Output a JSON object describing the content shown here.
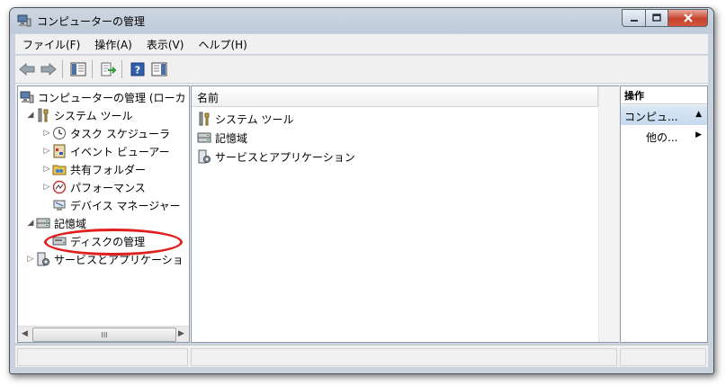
{
  "window": {
    "title": "コンピューターの管理"
  },
  "menubar": {
    "items": [
      "ファイル(F)",
      "操作(A)",
      "表示(V)",
      "ヘルプ(H)"
    ]
  },
  "toolbar": {
    "icons": [
      "back-arrow-icon",
      "forward-arrow-icon",
      "show-hide-tree-icon",
      "export-list-icon",
      "help-icon",
      "show-hide-action-pane-icon"
    ]
  },
  "tree": {
    "root": {
      "label": "コンピューターの管理 (ローカ"
    },
    "items": [
      {
        "label": "システム ツール",
        "state": "expanded"
      },
      {
        "label": "タスク スケジューラ",
        "state": "collapsed"
      },
      {
        "label": "イベント ビューアー",
        "state": "collapsed"
      },
      {
        "label": "共有フォルダー",
        "state": "collapsed"
      },
      {
        "label": "パフォーマンス",
        "state": "collapsed"
      },
      {
        "label": "デバイス マネージャー",
        "state": "leaf"
      },
      {
        "label": "記憶域",
        "state": "expanded"
      },
      {
        "label": "ディスクの管理",
        "state": "leaf"
      },
      {
        "label": "サービスとアプリケーショ",
        "state": "collapsed"
      }
    ],
    "scroll_thumb_label": "III"
  },
  "center": {
    "column_header": "名前",
    "items": [
      "システム ツール",
      "記憶域",
      "サービスとアプリケーション"
    ]
  },
  "actions": {
    "header": "操作",
    "section": "コンピュ...",
    "more": "他の..."
  },
  "colors": {
    "highlight_ellipse": "#e01f1f",
    "actions_section_bg": "#c6d9ee",
    "close_button": "#c7422b"
  }
}
